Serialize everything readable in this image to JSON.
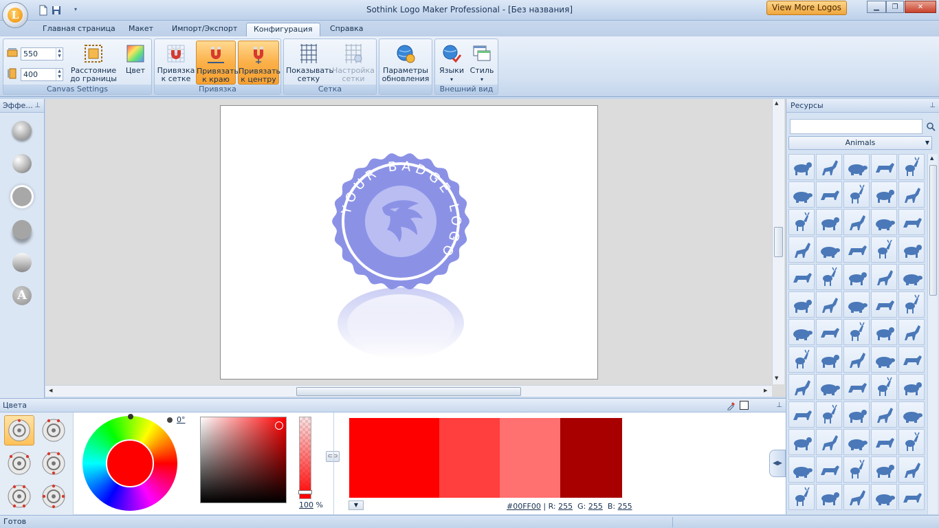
{
  "window": {
    "title": "Sothink Logo Maker Professional - [Без названия]",
    "view_more": "View More Logos",
    "orb_letter": "L"
  },
  "tabs": [
    "Главная страница",
    "Макет",
    "Импорт/Экспорт",
    "Конфигурация",
    "Справка"
  ],
  "active_tab": "Конфигурация",
  "ribbon": {
    "canvas_settings": {
      "label": "Canvas Settings",
      "width": "550",
      "height": "400",
      "distance_label_1": "Расстояние",
      "distance_label_2": "до границы",
      "color_label": "Цвет"
    },
    "snap": {
      "label": "Привязка",
      "grid_1": "Привязка",
      "grid_2": "к сетке",
      "edge_1": "Привязать",
      "edge_2": "к краю",
      "center_1": "Привязать",
      "center_2": "к центру"
    },
    "grid": {
      "label": "Сетка",
      "show_1": "Показывать",
      "show_2": "сетку",
      "settings_1": "Настройка",
      "settings_2": "сетки"
    },
    "update": {
      "label_1": "Параметры",
      "label_2": "обновления"
    },
    "appearance": {
      "label": "Внешний вид",
      "languages": "Языки",
      "style": "Стиль"
    }
  },
  "effects_panel": {
    "title": "Эффе..."
  },
  "canvas": {
    "badge_text": "YOUR BADGE LOGO",
    "badge_color": "#8b92e6"
  },
  "colors_panel": {
    "title": "Цвета",
    "angle": "0°",
    "opacity": "100",
    "opacity_unit": "%",
    "hex": "#00FF00",
    "r_label": "R:",
    "r": "255",
    "g_label": "G:",
    "g": "255",
    "b_label": "B:",
    "b": "255",
    "swatches": [
      "#ff0000",
      "#ff3e3e",
      "#ff7070",
      "#a80000"
    ]
  },
  "resources": {
    "title": "Ресурсы",
    "category": "Animals",
    "search_value": "",
    "icon_color": "#4a78b8"
  },
  "status": {
    "text": "Готов"
  }
}
